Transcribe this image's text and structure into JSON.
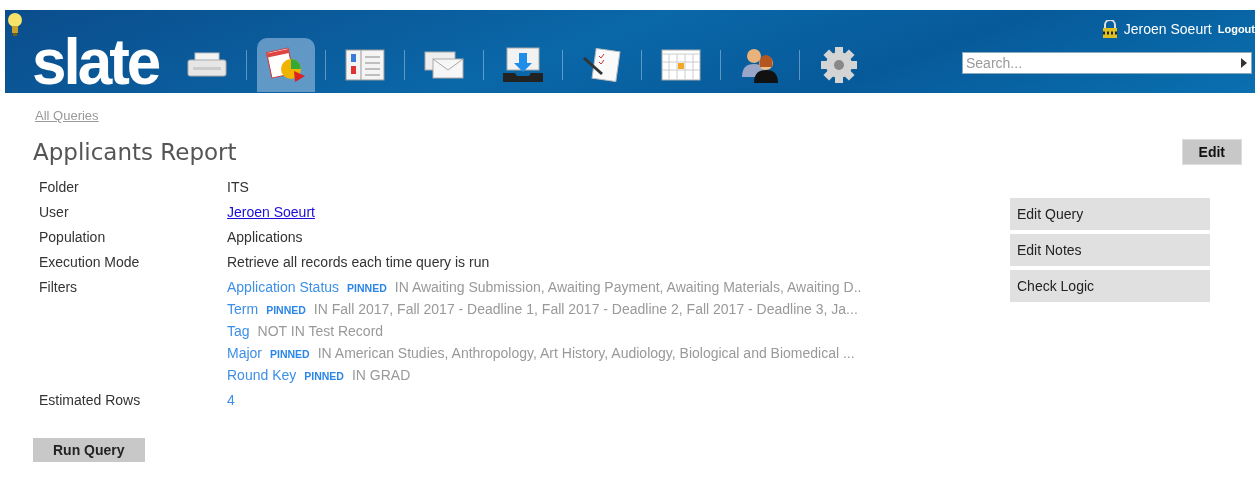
{
  "header": {
    "logo": "slate",
    "nav": [
      {
        "kind": "printer",
        "selected": false
      },
      {
        "kind": "report",
        "selected": true
      },
      {
        "kind": "form",
        "selected": false
      },
      {
        "kind": "mail",
        "selected": false
      },
      {
        "kind": "inbox",
        "selected": false
      },
      {
        "kind": "document",
        "selected": false
      },
      {
        "kind": "calendar",
        "selected": false
      },
      {
        "kind": "people",
        "selected": false
      },
      {
        "kind": "gear",
        "selected": false
      }
    ],
    "user": "Jeroen Soeurt",
    "logout": "Logout",
    "search": {
      "placeholder": "Search..."
    }
  },
  "breadcrumb": "All Queries",
  "title": "Applicants Report",
  "edit_button": "Edit",
  "details": [
    {
      "label": "Folder",
      "value": "ITS",
      "kind": "text"
    },
    {
      "label": "User",
      "value": "Jeroen Soeurt",
      "kind": "link"
    },
    {
      "label": "Population",
      "value": "Applications",
      "kind": "text"
    },
    {
      "label": "Execution Mode",
      "value": "Retrieve all records each time query is run",
      "kind": "text"
    }
  ],
  "filters_label": "Filters",
  "filters": [
    {
      "field": "Application Status",
      "pinned": true,
      "pin_label": "PINNED",
      "condition": "IN Awaiting Submission, Awaiting Payment, Awaiting Materials, Awaiting D.."
    },
    {
      "field": "Term",
      "pinned": true,
      "pin_label": "PINNED",
      "condition": "IN Fall 2017, Fall 2017 - Deadline 1, Fall 2017 - Deadline 2, Fall 2017 - Deadline 3, Ja..."
    },
    {
      "field": "Tag",
      "pinned": false,
      "condition": "NOT IN Test Record"
    },
    {
      "field": "Major",
      "pinned": true,
      "pin_label": "PINNED",
      "condition": "IN American Studies, Anthropology, Art History, Audiology, Biological and Biomedical ..."
    },
    {
      "field": "Round Key",
      "pinned": true,
      "pin_label": "PINNED",
      "condition": "IN GRAD"
    }
  ],
  "estimated_rows": {
    "label": "Estimated Rows",
    "value": "4"
  },
  "actions": [
    "Edit Query",
    "Edit Notes",
    "Check Logic"
  ],
  "run_button": "Run Query"
}
